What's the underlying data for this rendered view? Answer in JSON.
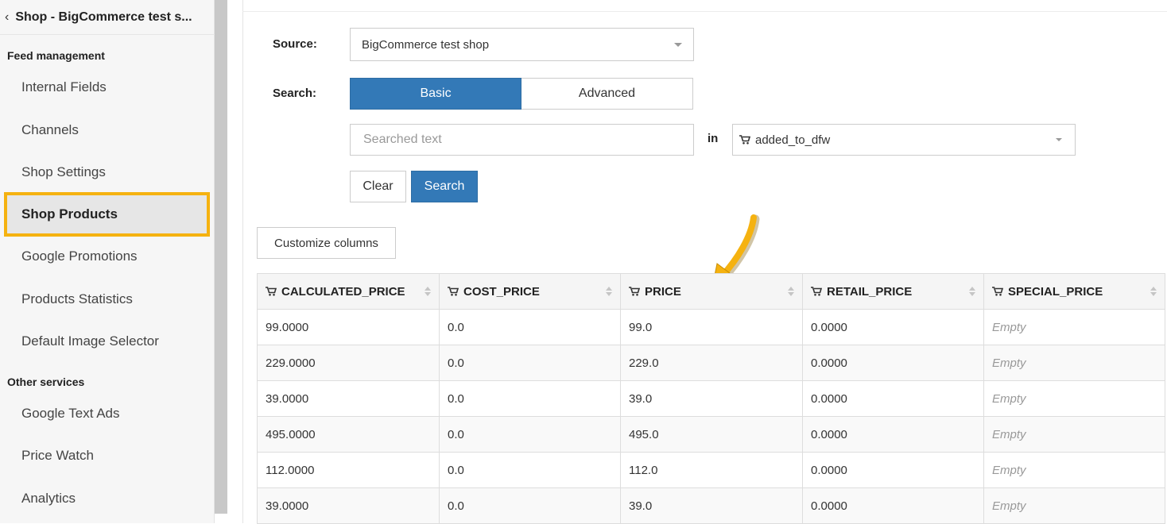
{
  "sidebar": {
    "back_label": "Shop - BigCommerce test s...",
    "sections": [
      {
        "title": "Feed management"
      },
      {
        "title": "Other services"
      }
    ],
    "items": [
      {
        "label": "Internal Fields"
      },
      {
        "label": "Channels"
      },
      {
        "label": "Shop Settings"
      },
      {
        "label": "Shop Products"
      },
      {
        "label": "Google Promotions"
      },
      {
        "label": "Products Statistics"
      },
      {
        "label": "Default Image Selector"
      },
      {
        "label": "Google Text Ads"
      },
      {
        "label": "Price Watch"
      },
      {
        "label": "Analytics"
      }
    ],
    "active_item": "Shop Products",
    "highlight_color": "#f5b210"
  },
  "form": {
    "source_label": "Source:",
    "source_value": "BigCommerce test shop",
    "search_label": "Search:",
    "mode_basic": "Basic",
    "mode_advanced": "Advanced",
    "search_placeholder": "Searched text",
    "in_label": "in",
    "field_value": "added_to_dfw",
    "clear_label": "Clear",
    "search_button": "Search",
    "customize_label": "Customize columns",
    "accent_color": "#3379b7"
  },
  "table": {
    "columns": [
      "CALCULATED_PRICE",
      "COST_PRICE",
      "PRICE",
      "RETAIL_PRICE",
      "SPECIAL_PRICE"
    ],
    "rows": [
      [
        "99.0000",
        "0.0",
        "99.0",
        "0.0000",
        "Empty"
      ],
      [
        "229.0000",
        "0.0",
        "229.0",
        "0.0000",
        "Empty"
      ],
      [
        "39.0000",
        "0.0",
        "39.0",
        "0.0000",
        "Empty"
      ],
      [
        "495.0000",
        "0.0",
        "495.0",
        "0.0000",
        "Empty"
      ],
      [
        "112.0000",
        "0.0",
        "112.0",
        "0.0000",
        "Empty"
      ],
      [
        "39.0000",
        "0.0",
        "39.0",
        "0.0000",
        "Empty"
      ]
    ]
  },
  "annotation": {
    "arrow_color": "#f5b210",
    "points_to": "PRICE"
  }
}
